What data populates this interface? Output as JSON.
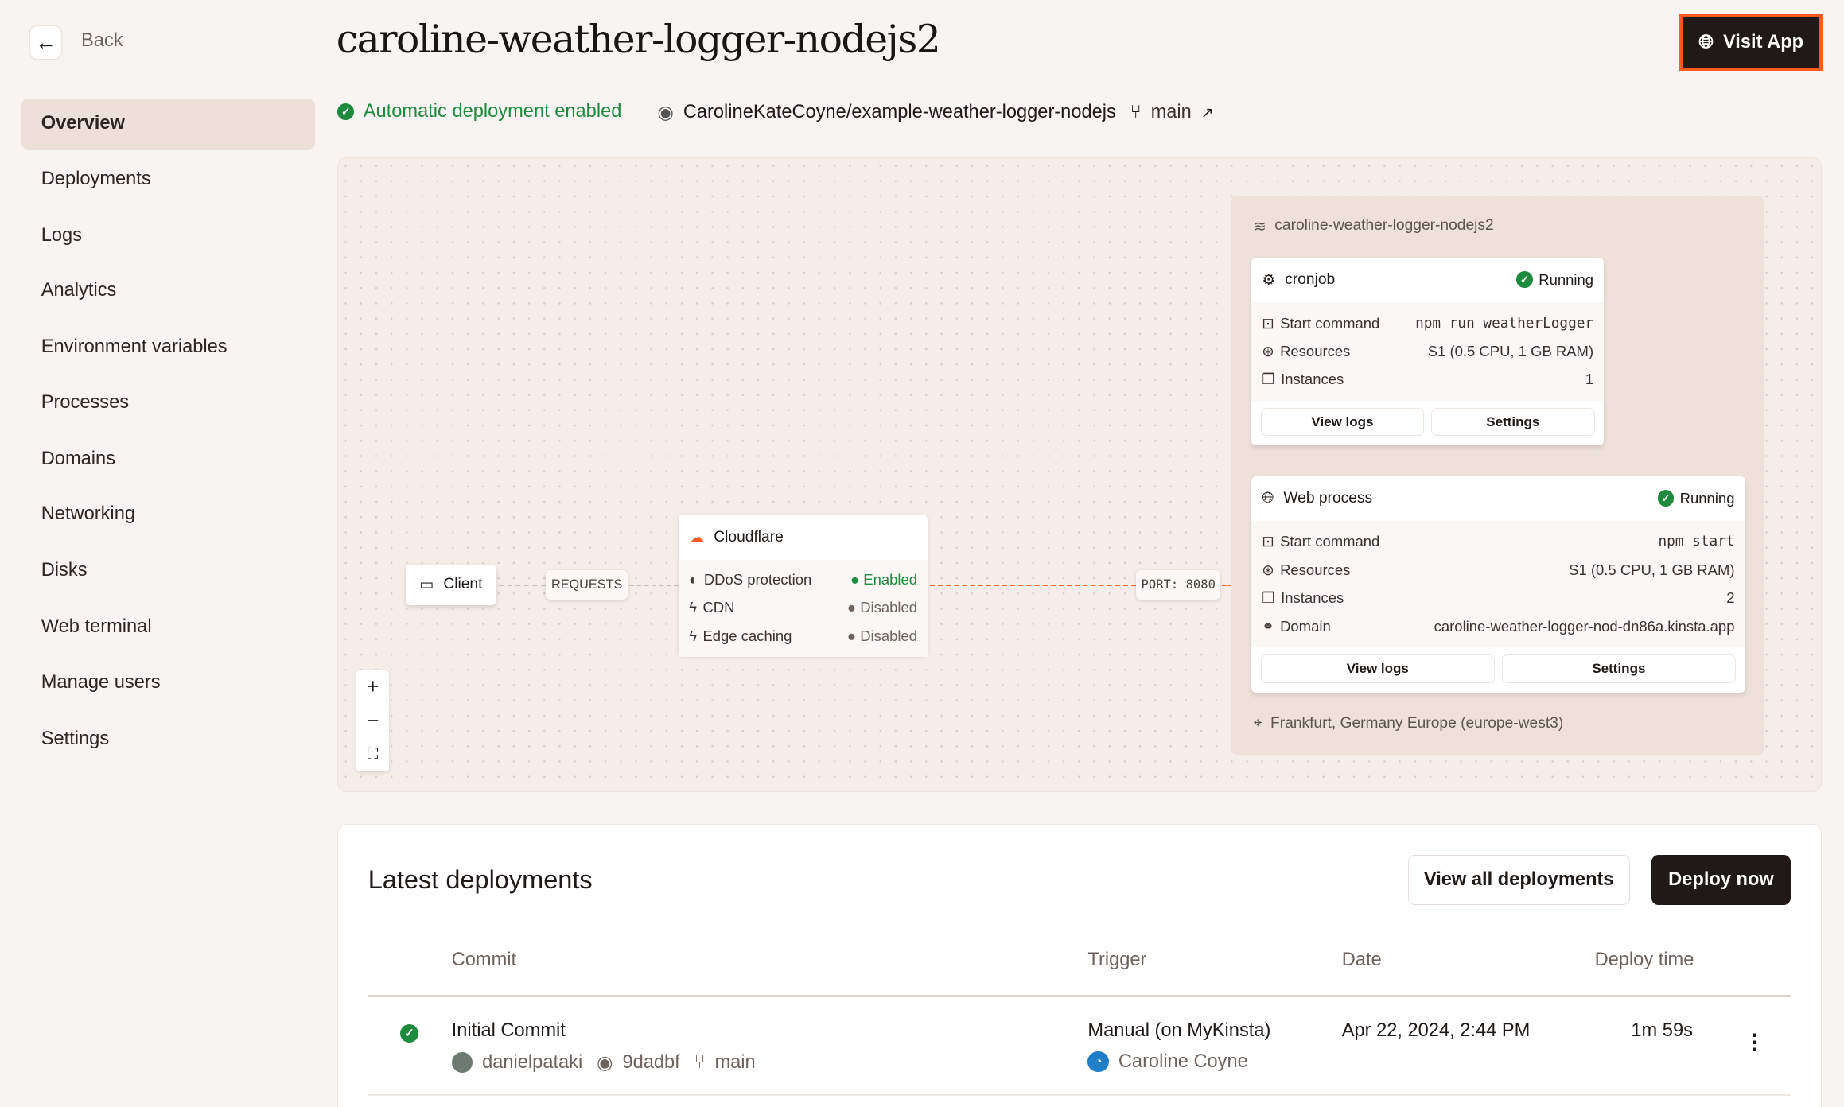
{
  "header": {
    "back_label": "Back",
    "title": "caroline-weather-logger-nodejs2",
    "visit_app": "Visit App"
  },
  "sidebar": {
    "items": [
      {
        "label": "Overview",
        "active": true
      },
      {
        "label": "Deployments"
      },
      {
        "label": "Logs"
      },
      {
        "label": "Analytics"
      },
      {
        "label": "Environment variables"
      },
      {
        "label": "Processes"
      },
      {
        "label": "Domains"
      },
      {
        "label": "Networking"
      },
      {
        "label": "Disks"
      },
      {
        "label": "Web terminal"
      },
      {
        "label": "Manage users"
      },
      {
        "label": "Settings"
      }
    ]
  },
  "status": {
    "auto_deploy": "Automatic deployment enabled",
    "repo": "CarolineKateCoyne/example-weather-logger-nodejs",
    "branch": "main"
  },
  "diagram": {
    "client": "Client",
    "requests": "REQUESTS",
    "port": "PORT: 8080",
    "cloudflare": {
      "title": "Cloudflare",
      "rows": [
        {
          "label": "DDoS protection",
          "value": "Enabled"
        },
        {
          "label": "CDN",
          "value": "Disabled"
        },
        {
          "label": "Edge caching",
          "value": "Disabled"
        }
      ]
    },
    "group_title": "caroline-weather-logger-nodejs2",
    "cronjob": {
      "title": "cronjob",
      "status": "Running",
      "start_label": "Start command",
      "start": "npm run weatherLogger",
      "res_label": "Resources",
      "res": "S1 (0.5 CPU, 1 GB RAM)",
      "inst_label": "Instances",
      "inst": "1",
      "view_logs": "View logs",
      "settings": "Settings"
    },
    "web": {
      "title": "Web process",
      "status": "Running",
      "start_label": "Start command",
      "start": "npm start",
      "res_label": "Resources",
      "res": "S1 (0.5 CPU, 1 GB RAM)",
      "inst_label": "Instances",
      "inst": "2",
      "domain_label": "Domain",
      "domain": "caroline-weather-logger-nod-dn86a.kinsta.app",
      "view_logs": "View logs",
      "settings": "Settings"
    },
    "location": "Frankfurt, Germany Europe (europe-west3)",
    "zoom": {
      "in": "+",
      "out": "−",
      "fit": "⛶"
    }
  },
  "deployments": {
    "title": "Latest deployments",
    "view_all": "View all deployments",
    "deploy_now": "Deploy now",
    "columns": [
      "Commit",
      "Trigger",
      "Date",
      "Deploy time"
    ],
    "rows": [
      {
        "commit": "Initial Commit",
        "author": "danielpataki",
        "hash": "9dadbf",
        "branch": "main",
        "trigger": "Manual (on MyKinsta)",
        "user": "Caroline Coyne",
        "date": "Apr 22, 2024, 2:44 PM",
        "time": "1m 59s"
      }
    ]
  },
  "colors": {
    "accent": "#ff5a1f",
    "success": "#1e8a3d",
    "dark": "#1f1a17"
  }
}
